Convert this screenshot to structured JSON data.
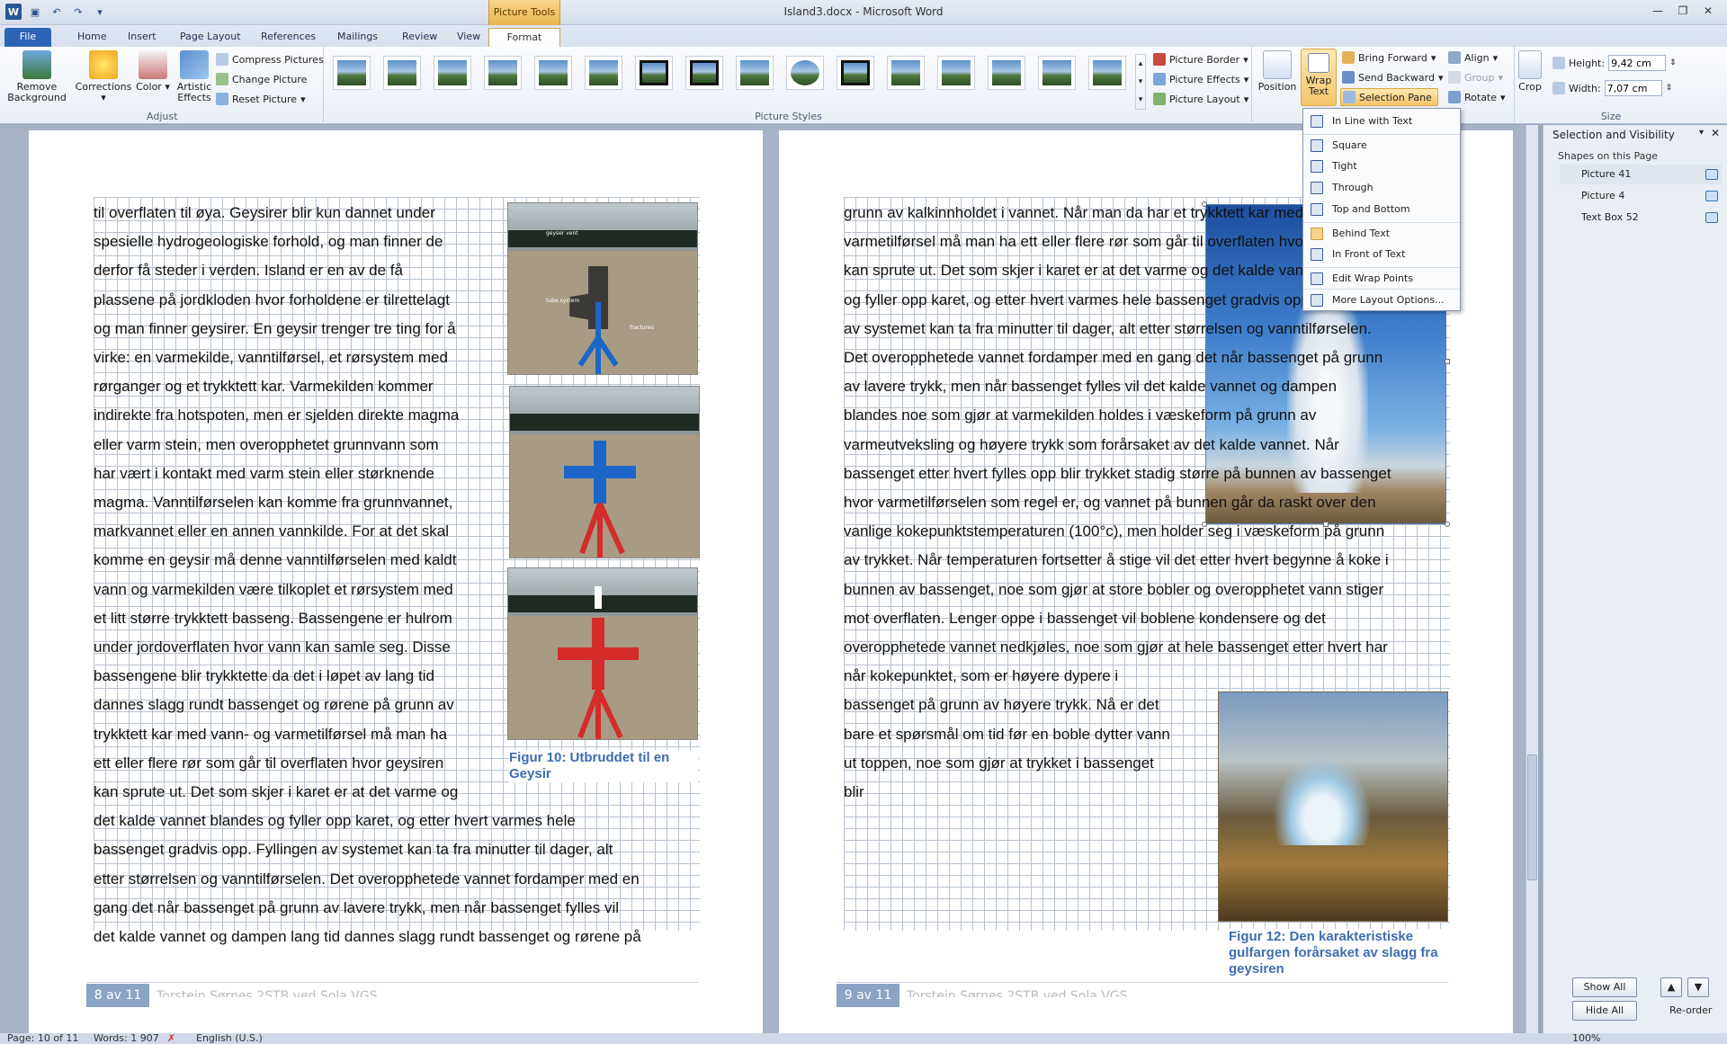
{
  "window": {
    "title": "Island3.docx - Microsoft Word",
    "contextual_tab_group": "Picture Tools"
  },
  "tabs": [
    "File",
    "Home",
    "Insert",
    "Page Layout",
    "References",
    "Mailings",
    "Review",
    "View",
    "Format"
  ],
  "ribbon": {
    "adjust": {
      "remove_background": "Remove Background",
      "corrections": "Corrections",
      "color": "Color",
      "artistic_effects": "Artistic Effects",
      "compress_pictures": "Compress Pictures",
      "change_picture": "Change Picture",
      "reset_picture": "Reset Picture",
      "label": "Adjust"
    },
    "picture_styles": {
      "label": "Picture Styles",
      "picture_border": "Picture Border",
      "picture_effects": "Picture Effects",
      "picture_layout": "Picture Layout"
    },
    "arrange": {
      "position": "Position",
      "wrap_text": "Wrap Text",
      "bring_forward": "Bring Forward",
      "send_backward": "Send Backward",
      "selection_pane": "Selection Pane",
      "align": "Align",
      "group": "Group",
      "rotate": "Rotate"
    },
    "size": {
      "crop": "Crop",
      "height_label": "Height:",
      "height_value": "9,42 cm",
      "width_label": "Width:",
      "width_value": "7,07 cm",
      "label": "Size"
    }
  },
  "wrap_menu": [
    "In Line with Text",
    "Square",
    "Tight",
    "Through",
    "Top and Bottom",
    "Behind Text",
    "In Front of Text",
    "Edit Wrap Points",
    "More Layout Options..."
  ],
  "page8": {
    "lines": [
      "til overflaten til øya. Geysirer blir kun dannet under",
      "spesielle hydrogeologiske forhold, og man finner de",
      "derfor få steder i verden. Island er en av de få",
      "plassene på jordkloden hvor forholdene er tilrettelagt",
      "og man finner geysirer. En geysir trenger tre ting for å",
      "virke: en varmekilde, vanntilførsel, et rørsystem med",
      "rørganger og et trykktett kar.  Varmekilden kommer",
      "indirekte fra hotspoten, men er sjelden direkte magma",
      "eller varm stein, men overopphetet grunnvann som",
      "har vært i kontakt med varm stein eller størknende",
      "magma. Vanntilførselen kan komme fra grunnvannet,",
      "markvannet eller en annen vannkilde. For at det skal",
      "komme en geysir må denne vanntilførselen med kaldt",
      "vann og varmekilden være tilkoplet et rørsystem med",
      "et litt større trykktett basseng. Bassengene er hulrom",
      "under jordoverflaten hvor vann kan samle seg. Disse",
      "bassengene blir trykktette da det i løpet av lang tid",
      "dannes slagg rundt bassenget og rørene på grunn av",
      "trykktett kar med vann- og varmetilførsel må man ha",
      "ett eller flere rør som går til overflaten hvor geysiren",
      "kan sprute ut.  Det som skjer i karet er at det varme og",
      "det kalde vannet blandes og fyller opp karet, og etter hvert varmes hele",
      "bassenget gradvis opp. Fyllingen av systemet kan ta fra minutter til dager, alt",
      "etter størrelsen og vanntilførselen. Det overopphetede vannet fordamper med en",
      "gang det når bassenget på grunn av lavere trykk, men når bassenget fylles vil",
      "det kalde vannet og dampen lang tid dannes slagg rundt bassenget og rørene på"
    ],
    "caption": "Figur 10: Utbruddet til en Geysir",
    "diagram_labels": [
      "geyser vent",
      "tube system",
      "fractures"
    ],
    "page_number": "8 av 11",
    "footer": "Torstein Sørnes 2STB ved Sola VGS"
  },
  "page9": {
    "lines": [
      "grunn av kalkinnholdet i vannet. Når man da har et trykktett kar med vann- og",
      "varmetilførsel må man ha ett eller flere rør som går til overflaten hvor geysiren",
      "kan sprute ut.  Det som skjer i karet er at det varme og det kalde vannet blandes",
      "og fyller opp karet, og etter hvert varmes hele bassenget gradvis opp. Fyllingen",
      "av systemet kan ta fra minutter til dager, alt etter størrelsen og vanntilførselen.",
      "Det overopphetede vannet fordamper med en gang det når bassenget på grunn",
      "av lavere trykk,  men når bassenget fylles vil det kalde vannet og dampen",
      "blandes noe som gjør at varmekilden holdes i væskeform på grunn av",
      "varmeutveksling og høyere trykk som forårsaket av det kalde vannet. Når",
      "bassenget etter hvert fylles opp blir trykket stadig større på bunnen av bassenget",
      "hvor varmetilførselen som regel er, og vannet på bunnen går da raskt over den",
      "vanlige kokepunktstemperaturen (100°c), men holder seg i væskeform på grunn",
      "av trykket. Når temperaturen fortsetter å stige vil det etter hvert begynne å koke i",
      "bunnen av bassenget, noe som gjør at store bobler og overopphetet vann stiger",
      "mot overflaten. Lenger oppe i bassenget vil boblene kondensere og det",
      "overopphetede vannet nedkjøles, noe som gjør at hele bassenget etter hvert har",
      "når kokepunktet, som er høyere dypere i",
      "bassenget på grunn av høyere trykk. Nå er det",
      "bare et spørsmål om tid før en boble dytter vann",
      "ut toppen, noe som gjør at trykket i bassenget",
      "blir"
    ],
    "caption": "Figur 12: Den karakteristiske gulfargen forårsaket av slagg fra geysiren",
    "page_number": "9 av 11",
    "footer": "Torstein Sørnes 2STB ved Sola VGS"
  },
  "selection_pane": {
    "title": "Selection and Visibility",
    "subtitle": "Shapes on this Page",
    "items": [
      "Picture 41",
      "Picture 4",
      "Text Box 52"
    ],
    "show_all": "Show All",
    "hide_all": "Hide All",
    "reorder": "Re-order"
  },
  "status": {
    "page": "Page: 10 of 11",
    "words": "Words: 1 907",
    "language": "English (U.S.)",
    "zoom": "100%"
  }
}
